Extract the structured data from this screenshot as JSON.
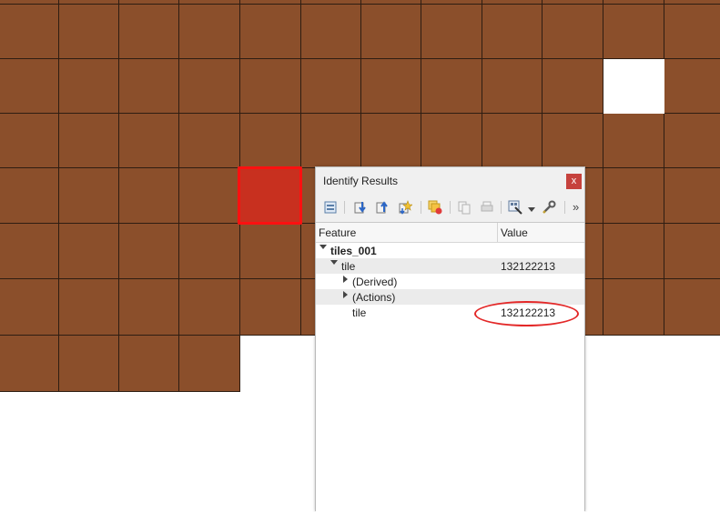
{
  "dialog": {
    "title": "Identify Results",
    "close_label": "x",
    "toolbar_more": "»"
  },
  "tree": {
    "headers": {
      "feature": "Feature",
      "value": "Value"
    },
    "layer": {
      "name": "tiles_001"
    },
    "feature": {
      "label": "tile",
      "value": "132122213"
    },
    "derived": {
      "label": "(Derived)"
    },
    "actions": {
      "label": "(Actions)"
    },
    "attribute": {
      "label": "tile",
      "value": "132122213"
    }
  },
  "colors": {
    "tile_fill": "#8b4f2b",
    "selected_tile": "#c8301f",
    "selection_outline": "#ff1010",
    "annotation_ellipse": "#e32828"
  }
}
